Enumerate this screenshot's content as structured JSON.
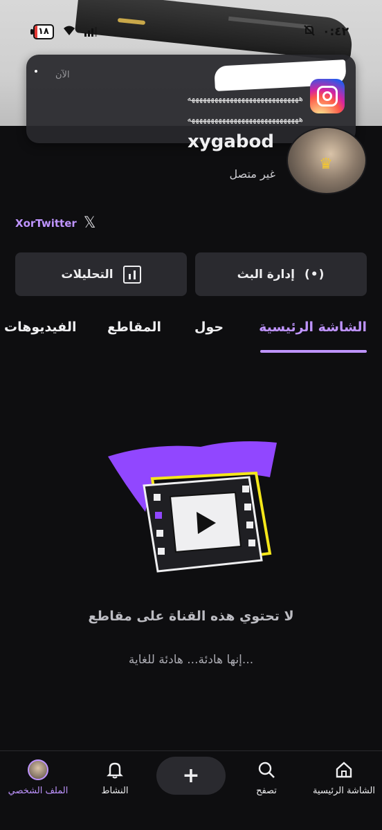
{
  "status_bar": {
    "time": "٠:٤٢",
    "battery": "١٨"
  },
  "notification": {
    "time": "الآن",
    "line1": "هههههههههههههههههههههههههههههه",
    "line2": "هههههههههههههههههههههههههههههه"
  },
  "profile": {
    "username": "xygabod",
    "presence": "غير متصل",
    "social_name": "XorTwitter"
  },
  "actions": {
    "stream_manager": "إدارة البث",
    "analytics": "التحليلات"
  },
  "tabs": [
    {
      "label": "الشاشة الرئيسية"
    },
    {
      "label": "حول"
    },
    {
      "label": "المقاطع"
    },
    {
      "label": "الفيديوهات"
    }
  ],
  "empty_state": {
    "title": "لا تحتوي هذه القناة على مقاطع",
    "subtitle": "إنها هادئة... هادئة للغاية..."
  },
  "bottom_nav": [
    {
      "label": "الشاشة الرئيسية",
      "icon": "home-icon"
    },
    {
      "label": "تصفح",
      "icon": "search-icon"
    },
    {
      "label": "النشاط",
      "icon": "bell-icon"
    },
    {
      "label": "الملف الشخصي",
      "icon": "avatar"
    }
  ],
  "colors": {
    "accent": "#bf94ff",
    "background": "#0e0e10",
    "button_bg": "#2a2a2f"
  }
}
